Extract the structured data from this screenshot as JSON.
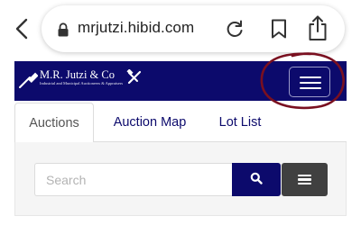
{
  "browser": {
    "url": "mrjutzi.hibid.com",
    "icons": [
      "back-chevron-icon",
      "lock-icon",
      "reload-icon",
      "bookmark-icon",
      "share-icon"
    ]
  },
  "site": {
    "logo_name": "M.R. Jutzi & Co",
    "logo_tagline": "Industrial and Municipal Auctioneers & Appraisers",
    "menu_icon": "hamburger-menu-icon",
    "header_color": "#0c0a6c"
  },
  "tabs": [
    {
      "label": "Auctions",
      "active": true
    },
    {
      "label": "Auction Map",
      "active": false
    },
    {
      "label": "Lot List",
      "active": false
    }
  ],
  "search": {
    "placeholder": "Search",
    "value": "",
    "search_icon": "search-icon",
    "filter_icon": "filter-list-icon"
  },
  "annotation": {
    "type": "hand-drawn circle",
    "color": "#7a1020"
  }
}
